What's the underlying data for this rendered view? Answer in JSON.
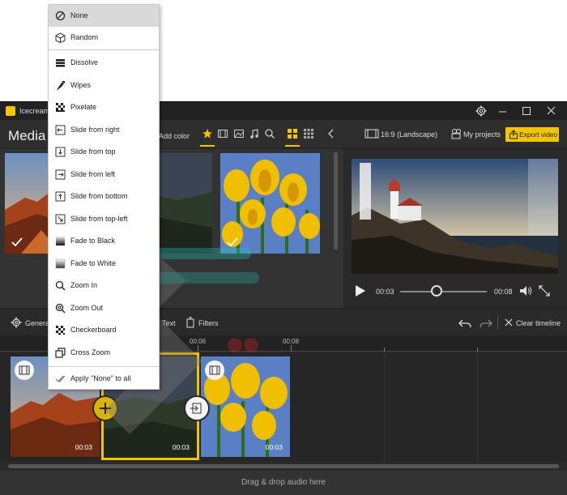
{
  "window": {
    "title": "Icecream",
    "controls": {
      "settings": "gear-icon",
      "minimize": "minimize-icon",
      "maximize": "maximize-icon",
      "close": "close-icon"
    }
  },
  "media_toolbar": {
    "title": "Media",
    "add_color_label": "Add color",
    "aspect_label": "16:9 (Landscape)",
    "my_projects_label": "My projects",
    "export_label": "Export video",
    "accent_color": "#f5c400"
  },
  "media_thumbs": [
    {
      "name": "Desert canyon",
      "checked": true
    },
    {
      "name": "Dark landscape",
      "checked": false
    },
    {
      "name": "Yellow tulips",
      "checked": true
    }
  ],
  "preview": {
    "time_current": "00:03",
    "time_total": "00:08",
    "progress": 0.42
  },
  "timeline_toolbar": {
    "general_label": "General",
    "text_label": "Text",
    "filters_label": "Filters",
    "clear_label": "Clear timeline"
  },
  "timeline": {
    "ruler_labels": [
      "00:06",
      "00:08"
    ],
    "clips": [
      {
        "duration": "00:03"
      },
      {
        "duration": "00:03"
      },
      {
        "duration": "00:03"
      }
    ]
  },
  "audio_drop_label": "Drag & drop audio here",
  "transitions_menu": {
    "selected": "None",
    "items": [
      {
        "label": "None",
        "icon": "none-icon"
      },
      {
        "label": "Random",
        "icon": "dice-icon"
      },
      {
        "label": "Dissolve",
        "icon": "dissolve-icon"
      },
      {
        "label": "Wipes",
        "icon": "wipes-icon"
      },
      {
        "label": "Pixelate",
        "icon": "pixelate-icon"
      },
      {
        "label": "Slide from right",
        "icon": "slide-right-icon"
      },
      {
        "label": "Slide from top",
        "icon": "slide-top-icon"
      },
      {
        "label": "Slide from left",
        "icon": "slide-left-icon"
      },
      {
        "label": "Slide from bottom",
        "icon": "slide-bottom-icon"
      },
      {
        "label": "Slide from top-left",
        "icon": "slide-top-left-icon"
      },
      {
        "label": "Fade to Black",
        "icon": "fade-black-icon"
      },
      {
        "label": "Fade to White",
        "icon": "fade-white-icon"
      },
      {
        "label": "Zoom In",
        "icon": "zoom-in-icon"
      },
      {
        "label": "Zoom Out",
        "icon": "zoom-out-icon"
      },
      {
        "label": "Checkerboard",
        "icon": "checkerboard-icon"
      },
      {
        "label": "Cross Zoom",
        "icon": "cross-zoom-icon"
      }
    ],
    "apply_all_label": "Apply \"None\" to all"
  }
}
